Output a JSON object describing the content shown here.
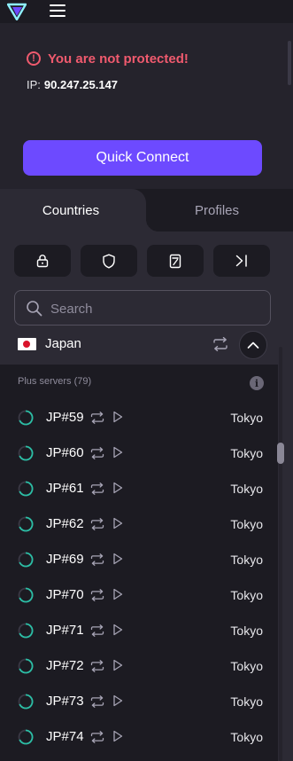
{
  "status": {
    "warning": "You are not protected!",
    "ip_label": "IP:",
    "ip_value": "90.247.25.147"
  },
  "quick_connect_label": "Quick Connect",
  "tabs": [
    {
      "label": "Countries",
      "active": true
    },
    {
      "label": "Profiles",
      "active": false
    }
  ],
  "filters": [
    {
      "icon": "lock-icon"
    },
    {
      "icon": "shield-icon"
    },
    {
      "icon": "tor-device-icon"
    },
    {
      "icon": "secure-core-arrow-icon"
    }
  ],
  "search": {
    "placeholder": "Search",
    "value": ""
  },
  "country": {
    "name": "Japan",
    "flag": "japan-flag-icon"
  },
  "group": {
    "label": "Plus servers (79)"
  },
  "servers": [
    {
      "name": "JP#59",
      "city": "Tokyo"
    },
    {
      "name": "JP#60",
      "city": "Tokyo"
    },
    {
      "name": "JP#61",
      "city": "Tokyo"
    },
    {
      "name": "JP#62",
      "city": "Tokyo"
    },
    {
      "name": "JP#69",
      "city": "Tokyo"
    },
    {
      "name": "JP#70",
      "city": "Tokyo"
    },
    {
      "name": "JP#71",
      "city": "Tokyo"
    },
    {
      "name": "JP#72",
      "city": "Tokyo"
    },
    {
      "name": "JP#73",
      "city": "Tokyo"
    },
    {
      "name": "JP#74",
      "city": "Tokyo"
    }
  ],
  "colors": {
    "accent": "#6d4aff",
    "warning": "#f05a6e",
    "load_good": "#2bbea5",
    "background": "#1c1b22"
  }
}
